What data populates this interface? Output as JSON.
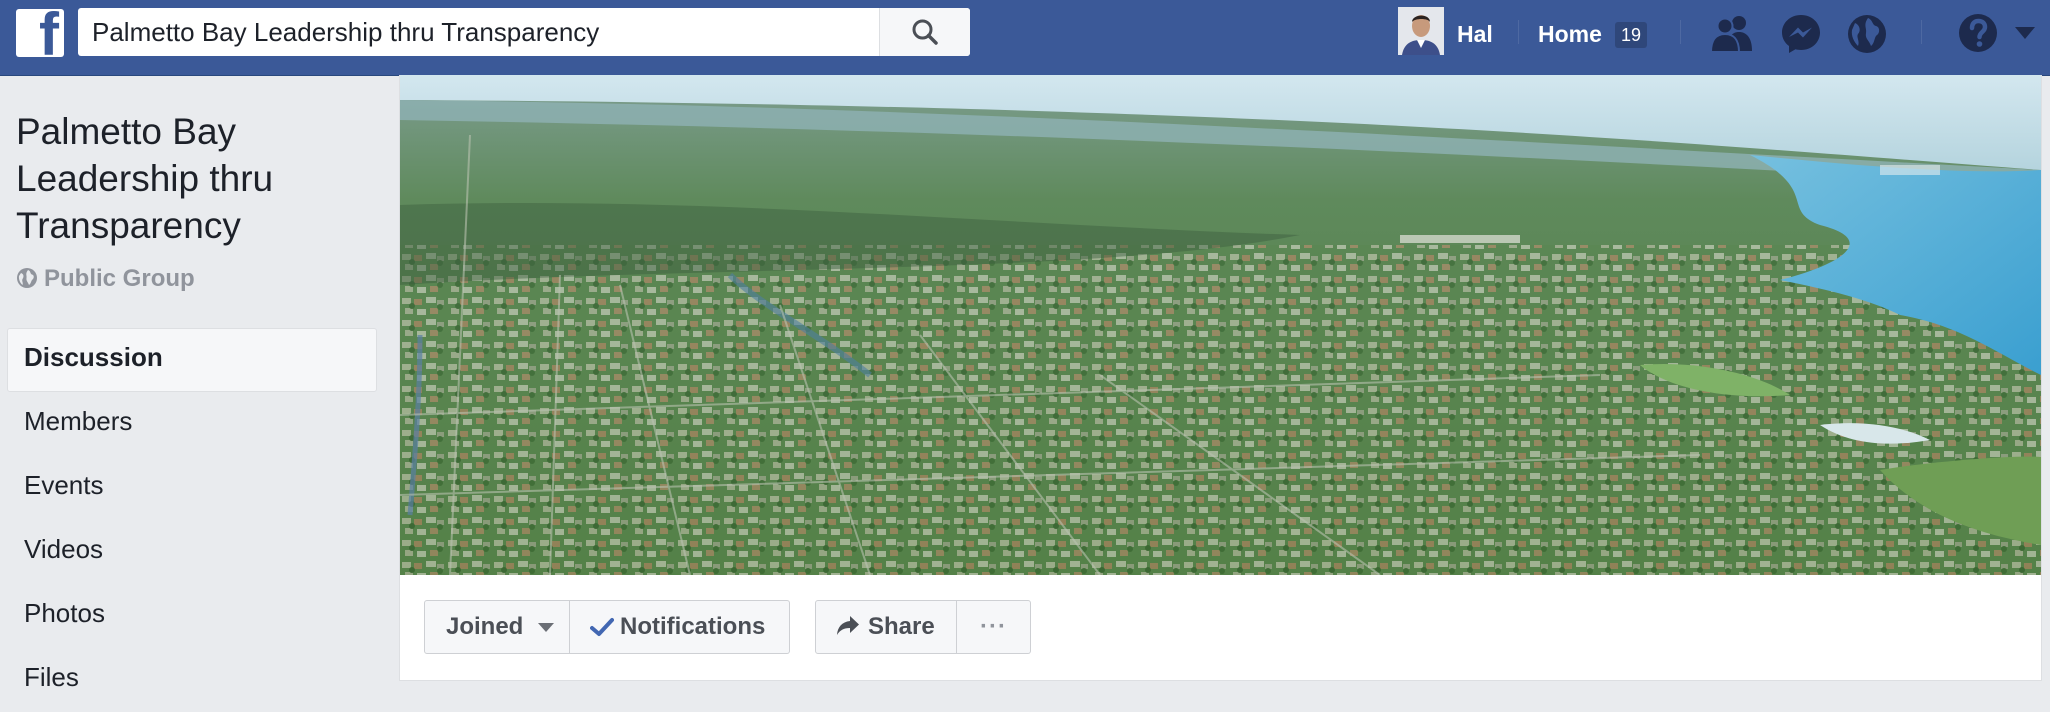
{
  "search": {
    "value": "Palmetto Bay Leadership thru Transparency"
  },
  "topnav": {
    "profile_name": "Hal",
    "home_label": "Home",
    "home_badge": "19",
    "icons": [
      "friend-requests-icon",
      "messenger-icon",
      "notifications-globe-icon",
      "help-icon",
      "account-menu-arrow-icon"
    ]
  },
  "group": {
    "title": "Palmetto Bay Leadership thru Transparency",
    "privacy": "Public Group"
  },
  "sidebar": {
    "items": [
      {
        "label": "Discussion",
        "active": true
      },
      {
        "label": "Members"
      },
      {
        "label": "Events"
      },
      {
        "label": "Videos"
      },
      {
        "label": "Photos"
      },
      {
        "label": "Files"
      }
    ]
  },
  "actions": {
    "joined_label": "Joined",
    "notifications_label": "Notifications",
    "share_label": "Share",
    "more_label": "···"
  },
  "colors": {
    "brand_blue": "#3b5998",
    "page_background": "#e9ebee",
    "check_blue": "#4267b2"
  }
}
